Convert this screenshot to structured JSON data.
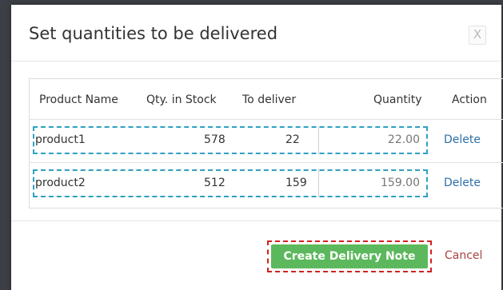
{
  "modal": {
    "title": "Set quantities to be delivered",
    "close_label": "X"
  },
  "table": {
    "headers": {
      "product_name": "Product Name",
      "qty_in_stock": "Qty. in Stock",
      "to_deliver": "To deliver",
      "quantity": "Quantity",
      "action": "Action"
    },
    "rows": [
      {
        "product_name": "product1",
        "qty_in_stock": "578",
        "to_deliver": "22",
        "quantity": "22.00",
        "action": "Delete"
      },
      {
        "product_name": "product2",
        "qty_in_stock": "512",
        "to_deliver": "159",
        "quantity": "159.00",
        "action": "Delete"
      }
    ]
  },
  "footer": {
    "create_label": "Create Delivery Note",
    "cancel_label": "Cancel"
  },
  "colors": {
    "primary_button": "#5cb85c",
    "highlight_dashed_blue": "#2fa1c2",
    "highlight_dashed_red": "#d32020",
    "link": "#2d6fa8",
    "cancel": "#a94442"
  }
}
